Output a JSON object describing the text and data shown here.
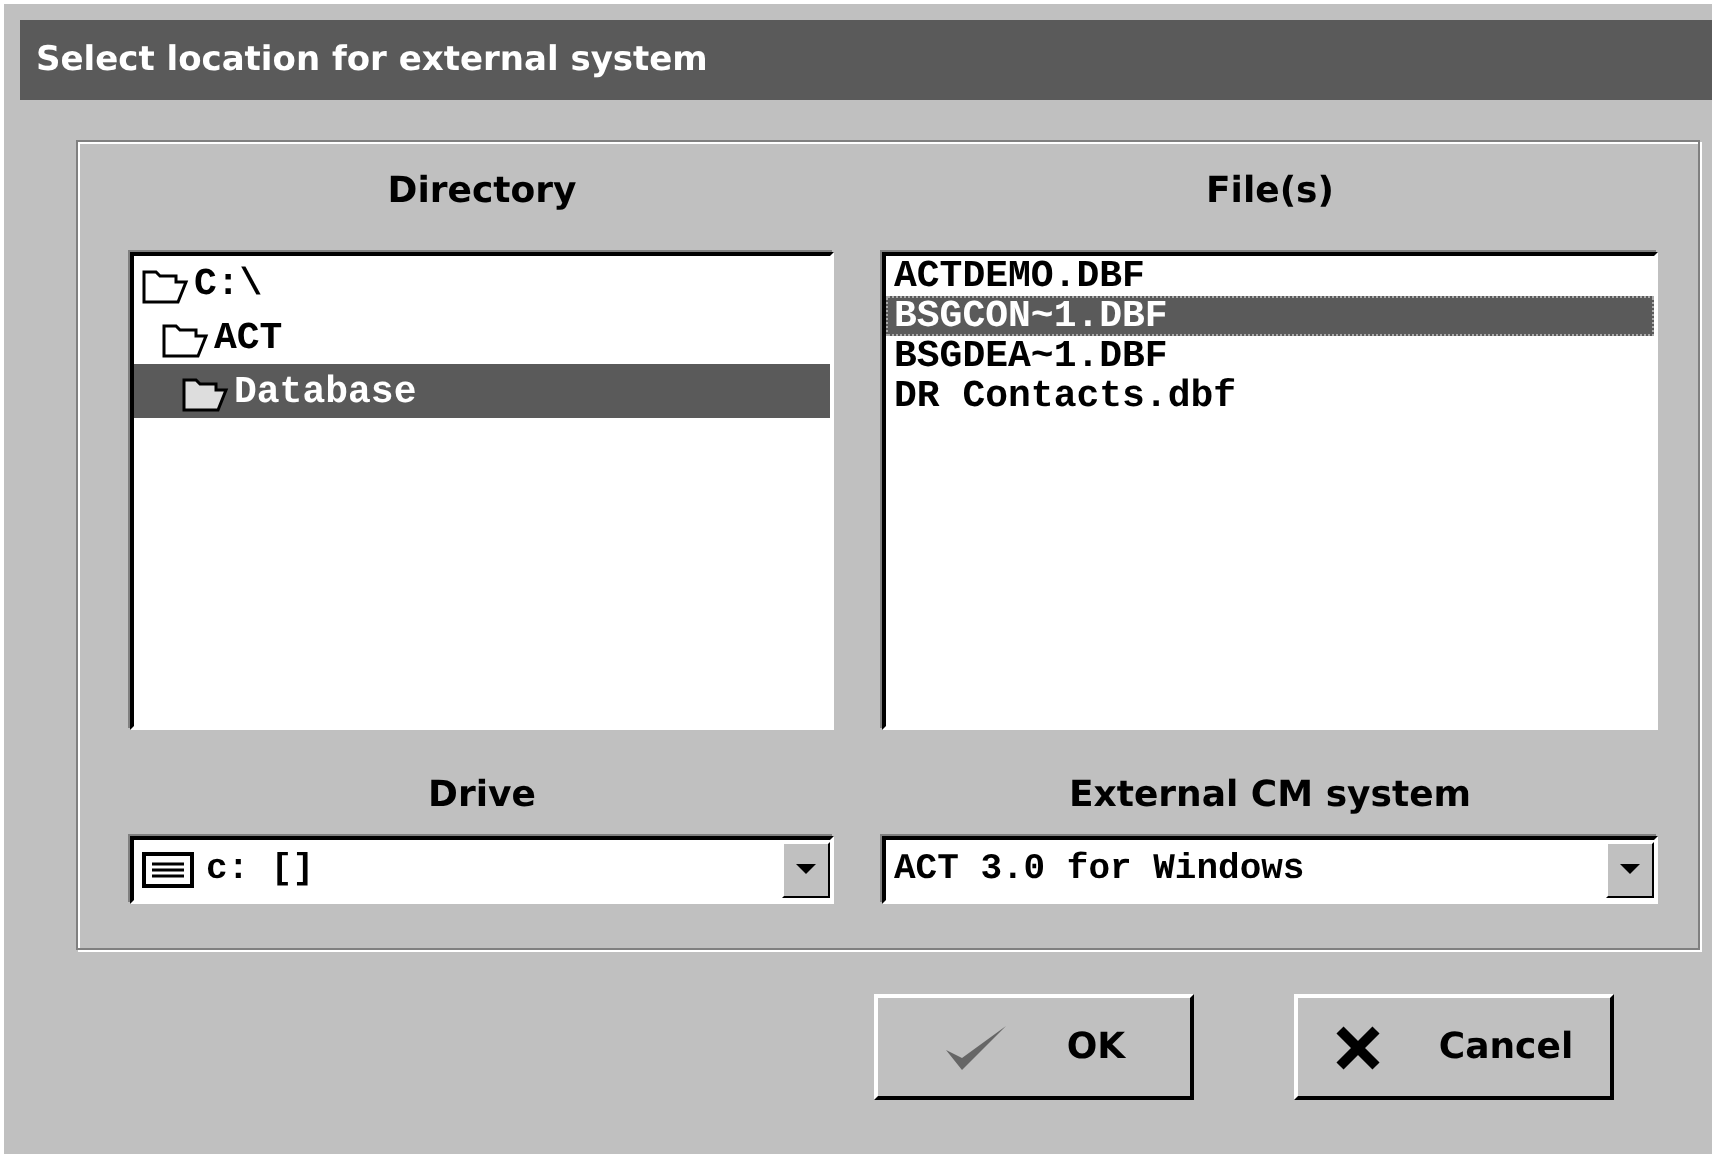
{
  "window": {
    "title": "Select location for external system"
  },
  "directory": {
    "label": "Directory",
    "tree": [
      {
        "name": "C:\\",
        "selected": false,
        "children": [
          {
            "name": "ACT",
            "selected": false,
            "children": [
              {
                "name": "Database",
                "selected": true
              }
            ]
          }
        ]
      }
    ]
  },
  "files": {
    "label": "File(s)",
    "items": [
      {
        "name": "ACTDEMO.DBF",
        "selected": false
      },
      {
        "name": "BSGCON~1.DBF",
        "selected": true
      },
      {
        "name": "BSGDEA~1.DBF",
        "selected": false
      },
      {
        "name": "DR Contacts.dbf",
        "selected": false
      }
    ]
  },
  "drive": {
    "label": "Drive",
    "value": "c: []"
  },
  "external_system": {
    "label": "External CM system",
    "value": "ACT 3.0 for Windows"
  },
  "buttons": [
    {
      "kind": "ok",
      "label": "OK"
    },
    {
      "kind": "cancel",
      "label": "Cancel"
    }
  ]
}
